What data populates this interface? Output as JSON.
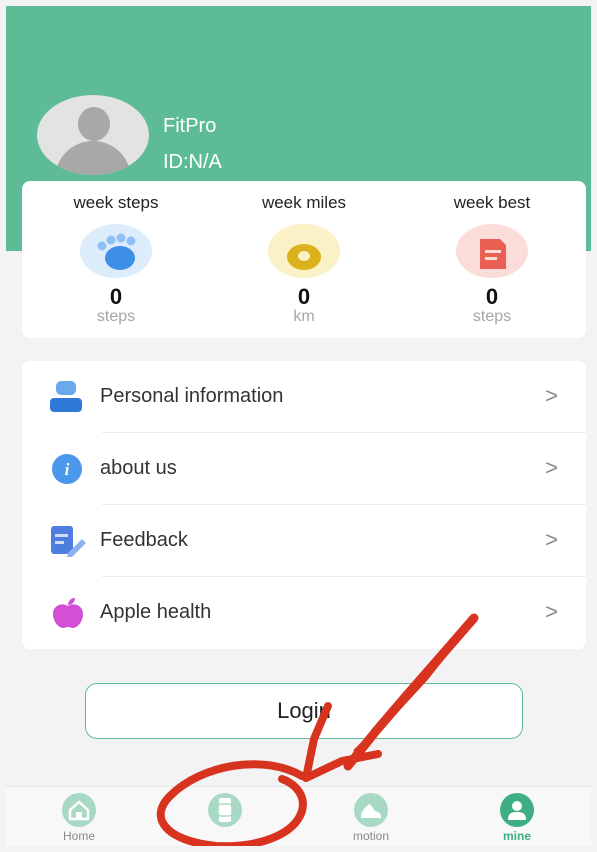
{
  "profile": {
    "name": "FitPro",
    "id": "ID:N/A"
  },
  "stats": [
    {
      "title": "week steps",
      "value": "0",
      "unit": "steps",
      "icon": "footprint-icon",
      "color": "#3d8fe6"
    },
    {
      "title": "week miles",
      "value": "0",
      "unit": "km",
      "icon": "distance-icon",
      "color": "#d9b21e"
    },
    {
      "title": "week best",
      "value": "0",
      "unit": "steps",
      "icon": "trophy-document-icon",
      "color": "#ea5e53"
    }
  ],
  "menu": [
    {
      "label": "Personal information",
      "icon": "person-icon"
    },
    {
      "label": "about us",
      "icon": "info-icon"
    },
    {
      "label": "Feedback",
      "icon": "feedback-icon"
    },
    {
      "label": "Apple health",
      "icon": "apple-icon"
    }
  ],
  "chevron": ">",
  "login_label": "Login",
  "tabs": [
    {
      "label": "Home",
      "icon": "home-icon",
      "active": false
    },
    {
      "label": "",
      "icon": "watch-icon",
      "active": false
    },
    {
      "label": "motion",
      "icon": "shoe-icon",
      "active": false
    },
    {
      "label": "mine",
      "icon": "user-icon",
      "active": true
    }
  ],
  "colors": {
    "accent": "#5dbb96",
    "annotation": "#d8331f"
  }
}
